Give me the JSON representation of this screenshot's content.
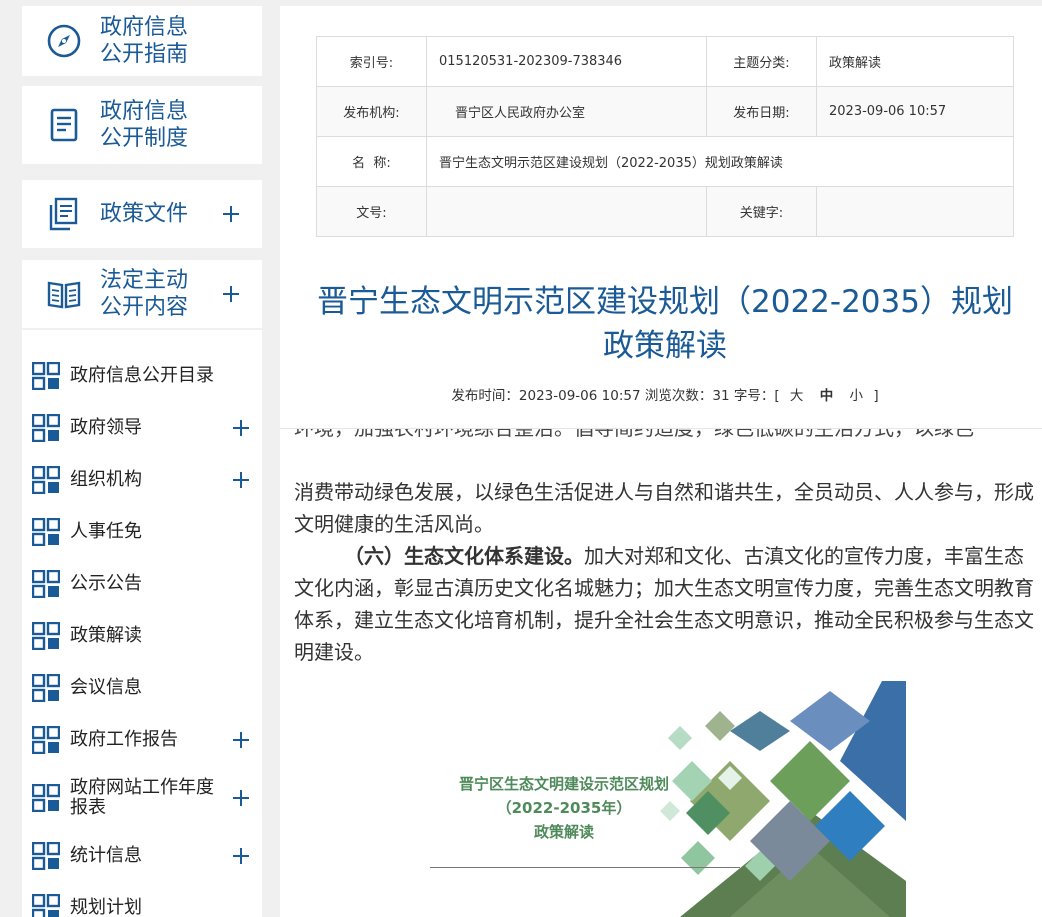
{
  "sidebar": {
    "cards": [
      {
        "label": "政府信息\n公开指南",
        "icon": "compass-icon"
      },
      {
        "label": "政府信息\n公开制度",
        "icon": "document-icon"
      },
      {
        "label": "政策文件",
        "icon": "files-icon"
      },
      {
        "label": "法定主动\n公开内容",
        "icon": "open-book-icon"
      }
    ],
    "menu": [
      {
        "label": "政府信息公开目录"
      },
      {
        "label": "政府领导"
      },
      {
        "label": "组织机构"
      },
      {
        "label": "人事任免"
      },
      {
        "label": "公示公告"
      },
      {
        "label": "政策解读"
      },
      {
        "label": "会议信息"
      },
      {
        "label": "政府工作报告"
      },
      {
        "label": "政府网站工作年度\n报表"
      },
      {
        "label": "统计信息"
      },
      {
        "label": "规划计划"
      }
    ]
  },
  "meta": {
    "index_label": "索引号:",
    "index_value": "015120531-202309-738346",
    "topic_label": "主题分类:",
    "topic_value": "政策解读",
    "publisher_label": "发布机构:",
    "publisher_value": "晋宁区人民政府办公室",
    "date_label": "发布日期:",
    "date_value": "2023-09-06 10:57",
    "name_label": "名  称:",
    "name_value": "晋宁生态文明示范区建设规划（2022-2035）规划政策解读",
    "docno_label": "文号:",
    "docno_value": "",
    "keyword_label": "关键字:",
    "keyword_value": ""
  },
  "article": {
    "title": "晋宁生态文明示范区建设规划（2022-2035）规划政策解读",
    "publish_time_label": "发布时间：",
    "publish_time": "2023-09-06 10:57",
    "views_label": "浏览次数：",
    "views": "31",
    "fontsize_label": "字号：[",
    "size_large": "大",
    "size_medium": "中",
    "size_small": "小",
    "fontsize_end": "]",
    "clipped_line": "环境，加强农村环境综合整治。倡导简约适度，绿色低碳的生活方式，以绿色",
    "para1": "消费带动绿色发展，以绿色生活促进人与自然和谐共生，全员动员、人人参与，形成文明健康的生活风尚。",
    "para2_heading": "（六）生态文化体系建设。",
    "para2_body": "加大对郑和文化、古滇文化的宣传力度，丰富生态文化内涵，彰显古滇历史文化名城魅力；加大生态文明宣传力度，完善生态文明教育体系，建立生态文化培育机制，提升全社会生态文明意识，推动全民积极参与生态文明建设。",
    "cover_line1": "晋宁区生态文明建设示范区规划",
    "cover_line2": "（2022-2035年）",
    "cover_line3": "政策解读"
  },
  "colors": {
    "brand_blue": "#1a5a96",
    "green_dark": "#4a7a55",
    "green_light": "#8fc6a0"
  }
}
